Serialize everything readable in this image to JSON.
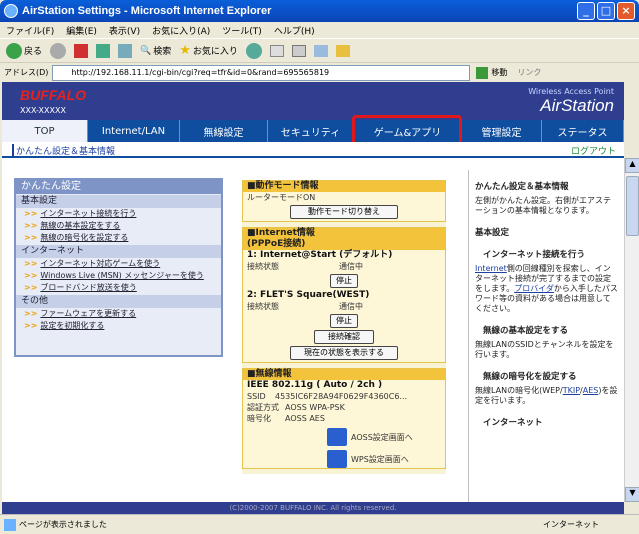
{
  "window": {
    "title": "AirStation Settings - Microsoft Internet Explorer"
  },
  "menu": [
    "ファイル(F)",
    "編集(E)",
    "表示(V)",
    "お気に入り(A)",
    "ツール(T)",
    "ヘルプ(H)"
  ],
  "toolbar": {
    "back": "戻る",
    "search": "検索",
    "favorites": "お気に入り"
  },
  "address": {
    "label": "アドレス(D)",
    "url": "http://192.168.11.1/cgi-bin/cgi?req=tfr&id=0&rand=695565819",
    "go": "移動",
    "links": "リンク"
  },
  "header": {
    "logo": "BUFFALO",
    "model": "XXX-XXXXX",
    "subtitle": "Wireless Access Point",
    "product": "AirStation"
  },
  "nav": [
    "TOP",
    "Internet/LAN",
    "無線設定",
    "セキュリティ",
    "ゲーム&アプリ",
    "管理設定",
    "ステータス"
  ],
  "subbar": {
    "left": "かんたん設定＆基本情報",
    "right": "ログアウト"
  },
  "left": {
    "title": "かんたん設定",
    "sections": [
      {
        "name": "基本設定",
        "links": [
          "インターネット接続を行う",
          "無線の基本設定をする",
          "無線の暗号化を設定する"
        ]
      },
      {
        "name": "インターネット",
        "links": [
          "インターネット対応ゲームを使う",
          "Windows Live (MSN) メッセンジャーを使う",
          "ブロードバンド放送を使う"
        ]
      },
      {
        "name": "その他",
        "links": [
          "ファームウェアを更新する",
          "設定を初期化する"
        ]
      }
    ]
  },
  "mid": {
    "mode_title": "■動作モード情報",
    "mode_value": "ルーターモードON",
    "mode_btn": "動作モード切り替え",
    "inet_title": "■Internet情報",
    "inet_sub": "(PPPoE接続)",
    "conn1": "1: Internet@Start (デフォルト)",
    "conn2": "2: FLET'S Square(WEST)",
    "state_label": "接続状態",
    "state_value": "通信中",
    "stop": "停止",
    "check": "接続確認",
    "show_state": "現在の状態を表示する",
    "wl_title": "■無線情報",
    "wl_std": "IEEE 802.11g ( Auto / 2ch )",
    "ssid_label": "SSID",
    "ssid": "4535IC6F28A94F0629F4360C6...",
    "auth_label": "認証方式",
    "auth": "AOSS WPA-PSK",
    "enc_label": "暗号化",
    "enc": "AOSS AES",
    "aoss": "AOSS設定画面へ",
    "wps": "WPS設定画面へ"
  },
  "right": {
    "title": "かんたん設定＆基本情報",
    "intro": "左側がかんたん設定。右側がエアステーションの基本情報となります。",
    "h1": "基本設定",
    "h2": "インターネット接続を行う",
    "p2a": "Internet",
    "p2b": "側の回線種別を探索し、インターネット接続が完了するまでの設定をします。",
    "p2c": "プロバイダ",
    "p2d": "から入手したパスワード等の資料がある場合は用意してください。",
    "h3": "無線の基本設定をする",
    "p3": "無線LANのSSIDとチャンネルを設定を行います。",
    "h4": "無線の暗号化を設定する",
    "p4a": "無線LANの暗号化(WEP/",
    "p4b": "TKIP",
    "p4c": "/",
    "p4d": "AES",
    "p4e": ")を設定を行います。",
    "h5": "インターネット"
  },
  "footer": "(C)2000-2007 BUFFALO INC. All rights reserved.",
  "status": {
    "left": "ページが表示されました",
    "right": "インターネット"
  }
}
